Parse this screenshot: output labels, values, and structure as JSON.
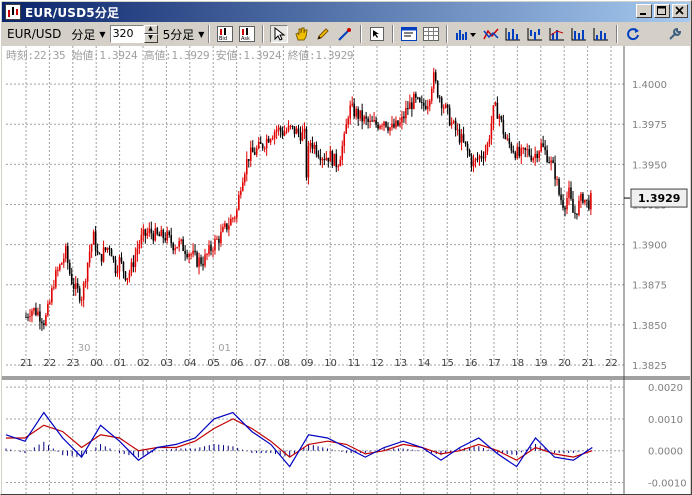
{
  "window": {
    "title": "EUR/USD5分足",
    "title_icon": "chart-app-icon",
    "buttons": [
      "minimize",
      "maximize",
      "close"
    ]
  },
  "toolbar": {
    "symbol": "EUR/USD",
    "period_type": "分足",
    "bar_count": "320",
    "timeframe": "5分足",
    "icons": [
      "bid-icon",
      "ask-icon",
      "pointer-icon",
      "hand-icon",
      "pencil-icon",
      "line-tool-icon",
      "cursor-crosshair-icon",
      "properties-icon",
      "data-table-icon",
      "indicator-menu-icon",
      "indicator-2-icon",
      "indicator-3-icon",
      "indicator-4-icon",
      "indicator-5-icon",
      "indicator-6-icon",
      "indicator-7-icon",
      "refresh-icon",
      "wrench-icon"
    ]
  },
  "info_line": "時刻:22:35 始値:1.3924 高値:1.3929 安値:1.3924 終値:1.3929",
  "colors": {
    "up_candle": "#e00000",
    "down_candle": "#000000",
    "grid": "#a0a0a0",
    "macd": "#0000c0",
    "signal": "#c00000",
    "histogram": "#000080",
    "title_start": "#0a246a",
    "title_end": "#a6caf0"
  },
  "chart_data": [
    {
      "type": "candlestick",
      "y_ticks": [
        "1.4000",
        "1.3975",
        "1.3950",
        "1.3925",
        "1.3900",
        "1.3875",
        "1.3850",
        "1.3825"
      ],
      "ylim": [
        1.3825,
        1.4015
      ],
      "current_price": "1.3929",
      "x_ticks": [
        "21",
        "22",
        "23",
        "00",
        "01",
        "02",
        "03",
        "04",
        "05",
        "06",
        "07",
        "08",
        "09",
        "10",
        "11",
        "12",
        "13",
        "14",
        "15",
        "16",
        "17",
        "18",
        "19",
        "20",
        "21",
        "22"
      ],
      "date_markers": [
        {
          "after_tick": 2,
          "label": "30"
        },
        {
          "after_tick": 8,
          "label": "01"
        }
      ],
      "close_path": [
        [
          0,
          1.3855
        ],
        [
          0.2,
          1.386
        ],
        [
          0.5,
          1.3858
        ],
        [
          0.8,
          1.3852
        ],
        [
          1.0,
          1.3862
        ],
        [
          1.2,
          1.3878
        ],
        [
          1.5,
          1.3888
        ],
        [
          1.7,
          1.3895
        ],
        [
          1.9,
          1.388
        ],
        [
          2.1,
          1.3872
        ],
        [
          2.4,
          1.3868
        ],
        [
          2.7,
          1.3895
        ],
        [
          2.9,
          1.3905
        ],
        [
          3.1,
          1.389
        ],
        [
          3.3,
          1.3895
        ],
        [
          3.6,
          1.39
        ],
        [
          3.8,
          1.3885
        ],
        [
          4.0,
          1.389
        ],
        [
          4.3,
          1.388
        ],
        [
          4.5,
          1.3885
        ],
        [
          4.8,
          1.39
        ],
        [
          5.0,
          1.3905
        ],
        [
          5.3,
          1.3908
        ],
        [
          5.6,
          1.3905
        ],
        [
          6.0,
          1.3905
        ],
        [
          6.3,
          1.39
        ],
        [
          6.6,
          1.39
        ],
        [
          7.0,
          1.3895
        ],
        [
          7.3,
          1.389
        ],
        [
          7.6,
          1.389
        ],
        [
          8.0,
          1.39
        ],
        [
          8.3,
          1.3905
        ],
        [
          8.6,
          1.3912
        ],
        [
          9.0,
          1.392
        ],
        [
          9.2,
          1.394
        ],
        [
          9.5,
          1.3955
        ],
        [
          9.8,
          1.3958
        ],
        [
          10.1,
          1.3962
        ],
        [
          10.4,
          1.3968
        ],
        [
          10.7,
          1.3972
        ],
        [
          11.0,
          1.397
        ],
        [
          11.3,
          1.3972
        ],
        [
          11.6,
          1.397
        ],
        [
          11.9,
          1.3968
        ],
        [
          12.0,
          1.394
        ],
        [
          12.1,
          1.3965
        ],
        [
          12.4,
          1.396
        ],
        [
          12.7,
          1.3955
        ],
        [
          13.0,
          1.3955
        ],
        [
          13.3,
          1.395
        ],
        [
          13.6,
          1.3965
        ],
        [
          13.8,
          1.3985
        ],
        [
          14.1,
          1.3982
        ],
        [
          14.4,
          1.3978
        ],
        [
          14.7,
          1.3975
        ],
        [
          15.0,
          1.3975
        ],
        [
          15.3,
          1.3978
        ],
        [
          15.6,
          1.3972
        ],
        [
          16.0,
          1.3975
        ],
        [
          16.3,
          1.3985
        ],
        [
          16.6,
          1.399
        ],
        [
          16.9,
          1.3985
        ],
        [
          17.2,
          1.399
        ],
        [
          17.4,
          1.4005
        ],
        [
          17.6,
          1.3995
        ],
        [
          17.9,
          1.3985
        ],
        [
          18.2,
          1.3975
        ],
        [
          18.5,
          1.3968
        ],
        [
          18.8,
          1.396
        ],
        [
          19.1,
          1.395
        ],
        [
          19.4,
          1.3955
        ],
        [
          19.7,
          1.396
        ],
        [
          20.0,
          1.3985
        ],
        [
          20.2,
          1.3982
        ],
        [
          20.5,
          1.3965
        ],
        [
          20.8,
          1.396
        ],
        [
          21.1,
          1.3955
        ],
        [
          21.4,
          1.3958
        ],
        [
          21.7,
          1.3955
        ],
        [
          22.0,
          1.3962
        ],
        [
          22.3,
          1.3955
        ],
        [
          22.6,
          1.3945
        ],
        [
          22.8,
          1.393
        ],
        [
          23.0,
          1.3925
        ],
        [
          23.2,
          1.3932
        ],
        [
          23.4,
          1.3918
        ],
        [
          23.6,
          1.3924
        ],
        [
          23.8,
          1.393
        ],
        [
          24.0,
          1.3925
        ],
        [
          24.2,
          1.3929
        ]
      ]
    },
    {
      "type": "line",
      "panel": "oscillator",
      "y_ticks": [
        "0.0020",
        "0.0010",
        "0.0000",
        "-0.0010"
      ],
      "ylim": [
        -0.0013,
        0.0021
      ],
      "series": [
        {
          "values": [
            0.0005,
            0.0003,
            0.0012,
            0.0004,
            -0.0002,
            0.0008,
            0.0003,
            -0.0003,
            0.0001,
            0.0002,
            0.0004,
            0.001,
            0.0012,
            0.0006,
            0.0002,
            -0.0005,
            0.0005,
            0.0004,
            0.0001,
            -0.0002,
            0.0001,
            0.0003,
            0.0001,
            -0.0003,
            0.0001,
            0.0004,
            -0.0001,
            -0.0005,
            0.0004,
            -0.0002,
            -0.0003,
            0.0001
          ]
        },
        {
          "values": [
            0.0004,
            0.0004,
            0.0008,
            0.0006,
            0.0001,
            0.0005,
            0.0004,
            0.0,
            0.0001,
            0.0001,
            0.0003,
            0.0007,
            0.001,
            0.0007,
            0.0003,
            -0.0002,
            0.0002,
            0.0003,
            0.0002,
            -0.0001,
            0.0,
            0.0002,
            0.0001,
            -0.0001,
            0.0,
            0.0002,
            0.0,
            -0.0003,
            0.0001,
            -0.0001,
            -0.0002,
            0.0
          ]
        }
      ]
    }
  ]
}
